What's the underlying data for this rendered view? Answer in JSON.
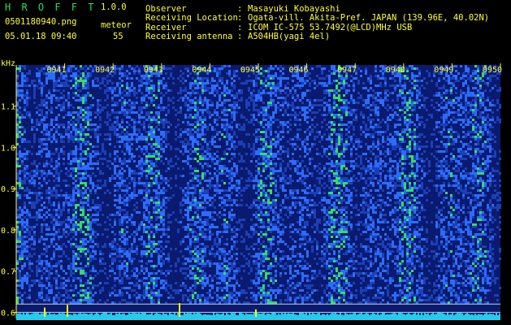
{
  "header": {
    "app_name": "H R O F F T",
    "version": "1.0.0",
    "filename": "0501180940.png",
    "mode_label": "meteor",
    "datetime": "05.01.18 09:40",
    "count": "55",
    "fields": [
      {
        "label": "Observer",
        "sep": ":",
        "value": "Masayuki Kobayashi"
      },
      {
        "label": "Receiving Location",
        "sep": ":",
        "value": "Ogata-vill. Akita-Pref. JAPAN (139.96E, 40.02N)"
      },
      {
        "label": "Receiver",
        "sep": ":",
        "value": "ICOM IC-575 53.7492(@LCD)MHz USB"
      },
      {
        "label": "Receiving antenna",
        "sep": ":",
        "value": "A504HB(yagi 4el)"
      }
    ]
  },
  "colors": {
    "background": "#000000",
    "header_green": "#22e05a",
    "header_yellow": "#ffff33",
    "tick_yellow": "#ffff33",
    "spectrum_low": "#0a1a6e",
    "spectrum_mid": "#2a6cff",
    "spectrum_high": "#33dd66",
    "baseline_cyan": "#22ccee",
    "baseline_yellow": "#ffff00"
  },
  "chart_data": {
    "type": "heatmap",
    "title": "",
    "ylabel": "kHz",
    "xlabel": "",
    "ylim": [
      0.6,
      1.2
    ],
    "y_ticks": [
      "1.1",
      "1.0",
      "0.9",
      "0.8",
      "0.7",
      "0.6"
    ],
    "y_tick_values": [
      1.1,
      1.0,
      0.9,
      0.8,
      0.7,
      0.6
    ],
    "x_ticks": [
      "0941",
      "0942",
      "0943",
      "0944",
      "0945",
      "0946",
      "0947",
      "0948",
      "0949",
      "0950"
    ],
    "x_tick_values": [
      941,
      942,
      943,
      944,
      945,
      946,
      947,
      948,
      949,
      950
    ],
    "xlim": [
      940,
      950
    ],
    "reference_lines_khz": [
      0.62,
      0.6
    ]
  }
}
